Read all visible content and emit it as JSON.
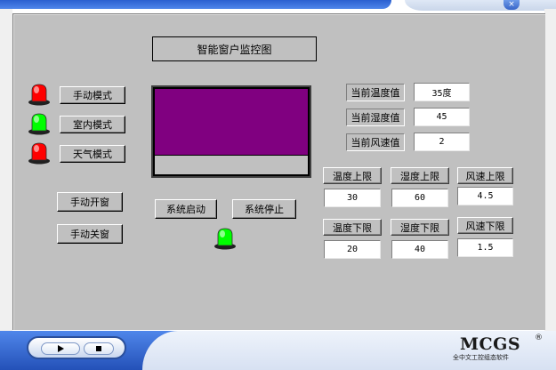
{
  "window": {
    "close_glyph": "×"
  },
  "title": "智能窗户监控图",
  "modes": [
    {
      "label": "手动模式",
      "lamp_color": "#ff0000"
    },
    {
      "label": "室内模式",
      "lamp_color": "#00ff00"
    },
    {
      "label": "天气模式",
      "lamp_color": "#ff0000"
    }
  ],
  "window_controls": {
    "open_label": "手动开窗",
    "close_label": "手动关窗"
  },
  "system": {
    "start_label": "系统启动",
    "stop_label": "系统停止",
    "lamp_color": "#00ff00"
  },
  "tank": {
    "fill_fraction": 0.77,
    "fill_color": "#800080"
  },
  "readings": [
    {
      "label": "当前温度值",
      "value": "35度"
    },
    {
      "label": "当前湿度值",
      "value": "45"
    },
    {
      "label": "当前风速值",
      "value": "2"
    }
  ],
  "upper_limits": [
    {
      "label": "温度上限",
      "value": "30"
    },
    {
      "label": "湿度上限",
      "value": "60"
    },
    {
      "label": "风速上限",
      "value": "4.5"
    }
  ],
  "lower_limits": [
    {
      "label": "温度下限",
      "value": "20"
    },
    {
      "label": "湿度下限",
      "value": "40"
    },
    {
      "label": "风速下限",
      "value": "1.5"
    }
  ],
  "brand": {
    "name": "MCGS",
    "reg": "®",
    "subtitle": "全中文工控组态软件"
  },
  "colors": {
    "panel_bg": "#c0c0c0",
    "taskbar_blue": "#2a5fd0"
  },
  "icons": {
    "play": "play-icon",
    "stop": "stop-icon",
    "lamp": "signal-lamp-icon"
  }
}
